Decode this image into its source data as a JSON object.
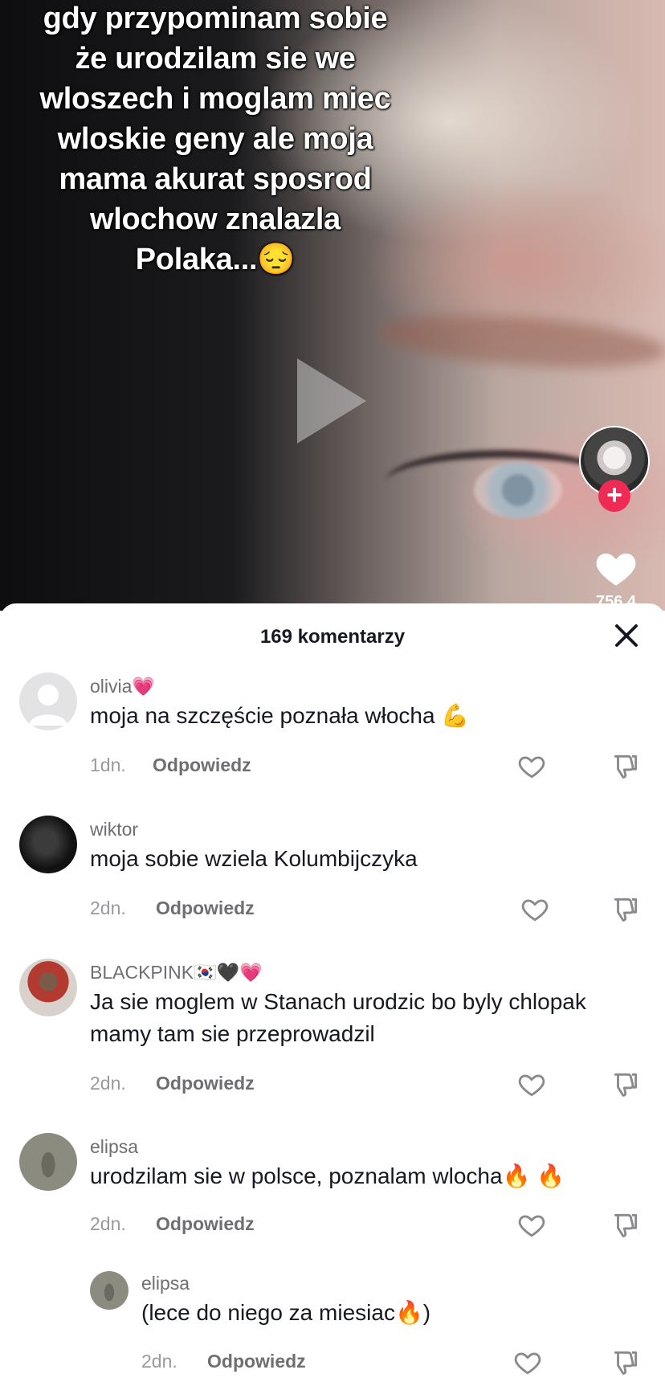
{
  "video": {
    "overlay_lines": [
      "gdy przypominam sobie",
      "że urodzilam sie we",
      "wloszech i moglam miec",
      "wloskie geny ale moja",
      "mama akurat sposrod",
      "wlochow znalazla",
      "Polaka...😔"
    ],
    "like_count": "756.4"
  },
  "sheet": {
    "title": "169 komentarzy"
  },
  "comments": [
    {
      "username": "olivia💗",
      "text": "moja na szczęście poznała włocha 💪",
      "time": "1dn.",
      "reply": "Odpowiedz"
    },
    {
      "username": "wiktor",
      "text": "moja sobie wziela Kolumbijczyka",
      "time": "2dn.",
      "reply": "Odpowiedz"
    },
    {
      "username": "BLACKPINK🇰🇷🖤💗",
      "text": "Ja sie moglem w Stanach urodzic bo byly chlopak mamy tam sie przeprowadzil",
      "time": "2dn.",
      "reply": "Odpowiedz"
    },
    {
      "username": "elipsa",
      "text": "urodzilam sie w polsce, poznalam wlocha🔥 🔥",
      "time": "2dn.",
      "reply": "Odpowiedz"
    },
    {
      "username": "elipsa",
      "text": "(lece do niego za miesiac🔥)",
      "time": "2dn.",
      "reply": "Odpowiedz"
    }
  ]
}
